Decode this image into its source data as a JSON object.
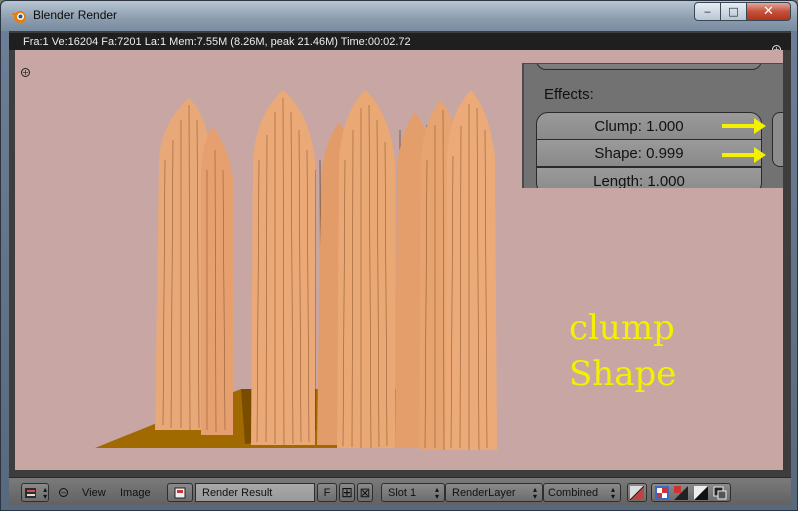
{
  "window": {
    "title": "Blender Render",
    "buttons": {
      "minimize": "‒",
      "maximize": "□",
      "close": "✕"
    }
  },
  "info": {
    "text": "Fra:1  Ve:16204 Fa:7201 La:1 Mem:7.55M (8.26M, peak 21.46M) Time:00:02.72"
  },
  "panel": {
    "effects_label": "Effects:",
    "clump": "Clump: 1.000",
    "shape": "Shape: 0.999",
    "length": "Length: 1.000"
  },
  "annotation": {
    "line1": "clump",
    "line2": "Shape",
    "color": "#f4f100"
  },
  "header": {
    "menu_view": "View",
    "menu_image": "Image",
    "image_name": "Render Result",
    "fake_user": "F",
    "slot": "Slot 1",
    "layer": "RenderLayer",
    "pass": "Combined"
  },
  "icons": {
    "editor_type": "image-editor-icon",
    "collapse": "collapse-circle-icon",
    "browse_image": "image-browse-icon",
    "new_image": "plus-icon",
    "unlink": "x-icon",
    "draw_mode": "draw-mode-icons"
  }
}
